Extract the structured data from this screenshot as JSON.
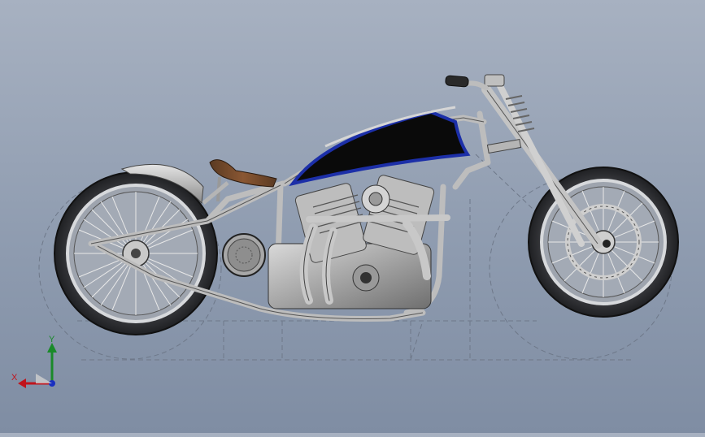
{
  "viewport": {
    "background_top": "#a7b1c1",
    "background_bottom": "#7f8da3"
  },
  "model": {
    "tank_color": "#0a0a0a",
    "tank_trim_color": "#1c2fa8",
    "seat_color": "#7a4a2a",
    "frame_color": "#c9c9c9",
    "tire_color": "#2f3033",
    "rim_color": "#b9bcc2"
  },
  "triad": {
    "x_label": "X",
    "y_label": "Y",
    "x_color": "#c0141c",
    "y_color": "#1a8a2a",
    "z_color": "#1a2fc0"
  }
}
